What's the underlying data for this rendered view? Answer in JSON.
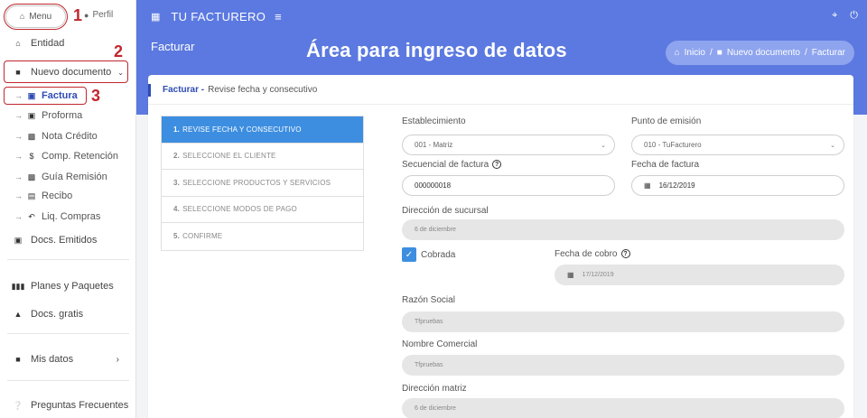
{
  "sidebar": {
    "menu_label": "Menu",
    "perfil_label": "Perfil",
    "items": [
      {
        "label": "Entidad",
        "icon": "home-icon"
      },
      {
        "label": "Nuevo documento",
        "icon": "document-icon"
      },
      {
        "label": "Docs. Emitidos",
        "icon": "clipboard-icon"
      },
      {
        "label": "Planes y Paquetes",
        "icon": "bars-icon"
      },
      {
        "label": "Docs. gratis",
        "icon": "gift-icon"
      },
      {
        "label": "Mis datos",
        "icon": "id-card-icon"
      },
      {
        "label": "Preguntas Frecuentes",
        "icon": "question-icon"
      }
    ],
    "sub_items": [
      {
        "label": "Factura"
      },
      {
        "label": "Proforma"
      },
      {
        "label": "Nota Crédito"
      },
      {
        "label": "Comp. Retención"
      },
      {
        "label": "Guía Remisión"
      },
      {
        "label": "Recibo"
      },
      {
        "label": "Liq. Compras"
      }
    ],
    "markers": [
      "1",
      "2",
      "3"
    ]
  },
  "topbar": {
    "app_title": "TU FACTURERO"
  },
  "header": {
    "page_title": "Facturar",
    "annotation": "Área para ingreso de datos",
    "breadcrumb": [
      "Inicio",
      "/",
      "Nuevo documento",
      "/",
      "Facturar"
    ]
  },
  "card": {
    "head_strong": "Facturar -",
    "head_sub": "Revise fecha y consecutivo",
    "steps": [
      {
        "num": "1.",
        "label": "REVISE FECHA Y CONSECUTIVO"
      },
      {
        "num": "2.",
        "label": "SELECCIONE EL CLIENTE"
      },
      {
        "num": "3.",
        "label": "SELECCIONE PRODUCTOS Y SERVICIOS"
      },
      {
        "num": "4.",
        "label": "SELECCIONE MODOS DE PAGO"
      },
      {
        "num": "5.",
        "label": "CONFIRME"
      }
    ],
    "form": {
      "establecimiento_label": "Establecimiento",
      "establecimiento_value": "001 - Matriz",
      "punto_label": "Punto de emisión",
      "punto_value": "010 - TuFacturero",
      "secuencial_label": "Secuencial de factura",
      "secuencial_value": "000000018",
      "fecha_label": "Fecha de factura",
      "fecha_value": "16/12/2019",
      "direccion_sucursal_label": "Dirección de sucursal",
      "direccion_sucursal_value": "6 de diciembre",
      "cobrada_label": "Cobrada",
      "fecha_cobro_label": "Fecha de cobro",
      "fecha_cobro_value": "17/12/2019",
      "razon_label": "Razón Social",
      "razon_value": "Tfpruebas",
      "nombre_label": "Nombre Comercial",
      "nombre_value": "Tfpruebas",
      "direccion_matriz_label": "Dirección matriz",
      "direccion_matriz_value": "6 de diciembre"
    }
  }
}
